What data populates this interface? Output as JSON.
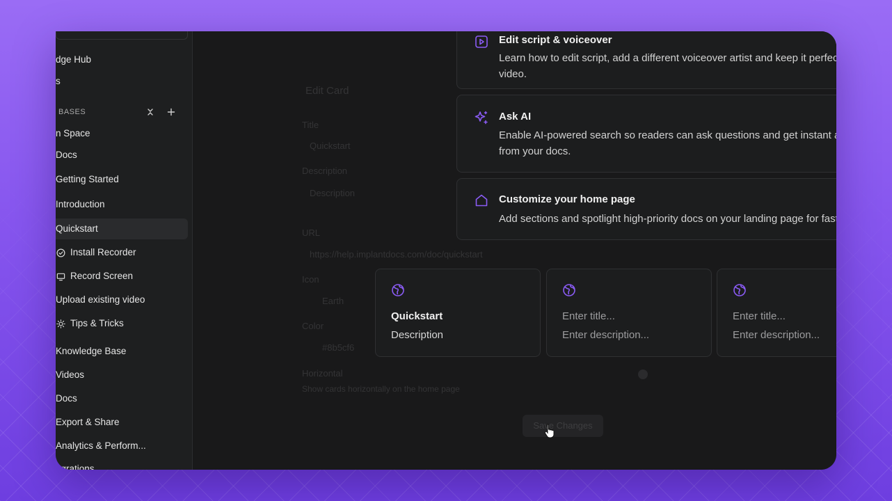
{
  "sidebar": {
    "items": [
      {
        "label": "dge Hub"
      },
      {
        "label": "s"
      },
      {
        "label": "n Space"
      },
      {
        "label": "Docs"
      },
      {
        "label": "Getting Started"
      },
      {
        "label": "Introduction"
      },
      {
        "label": "Quickstart"
      },
      {
        "label": "Install Recorder"
      },
      {
        "label": "Record Screen"
      },
      {
        "label": "Upload existing video"
      },
      {
        "label": "Tips & Tricks"
      },
      {
        "label": "Knowledge Base"
      },
      {
        "label": "Videos"
      },
      {
        "label": "Docs"
      },
      {
        "label": "Export & Share"
      },
      {
        "label": "Analytics & Perform..."
      },
      {
        "label": "egrations"
      }
    ],
    "section_label": "BASES",
    "section_actions": [
      "collapse-icon",
      "plus-icon"
    ]
  },
  "background_form": {
    "title": "Edit Card",
    "fields": [
      "Title",
      "Quickstart",
      "Description",
      "Description",
      "URL",
      "https://help.implantdocs.com/doc/quickstart",
      "Icon",
      "Earth",
      "Color",
      "#8b5cf6",
      "Horizontal",
      "Show cards horizontally on the home page"
    ],
    "button": "Save Changes"
  },
  "features": [
    {
      "icon": "play-square-icon",
      "title": "Edit script & voiceover",
      "desc": "Learn how to edit script, add a different voiceover artist and keep it perfectly in sync with the video."
    },
    {
      "icon": "sparkle-icon",
      "title": "Ask AI",
      "desc": "Enable AI-powered search so readers can ask questions and get instant answers pulled straight from your docs."
    },
    {
      "icon": "home-icon",
      "title": "Customize your home page",
      "desc": "Add sections and spotlight high-priority docs on your landing page for faster access."
    }
  ],
  "tiles": [
    {
      "icon": "globe-icon",
      "title": "Quickstart",
      "desc": "Description"
    },
    {
      "icon": "globe-icon",
      "title_placeholder": "Enter title...",
      "desc_placeholder": "Enter description..."
    },
    {
      "icon": "globe-icon",
      "title_placeholder": "Enter title...",
      "desc_placeholder": "Enter description..."
    }
  ],
  "colors": {
    "accent": "#8b5cf6",
    "background": "#1c1d1e",
    "text": "#f0f0f0"
  }
}
